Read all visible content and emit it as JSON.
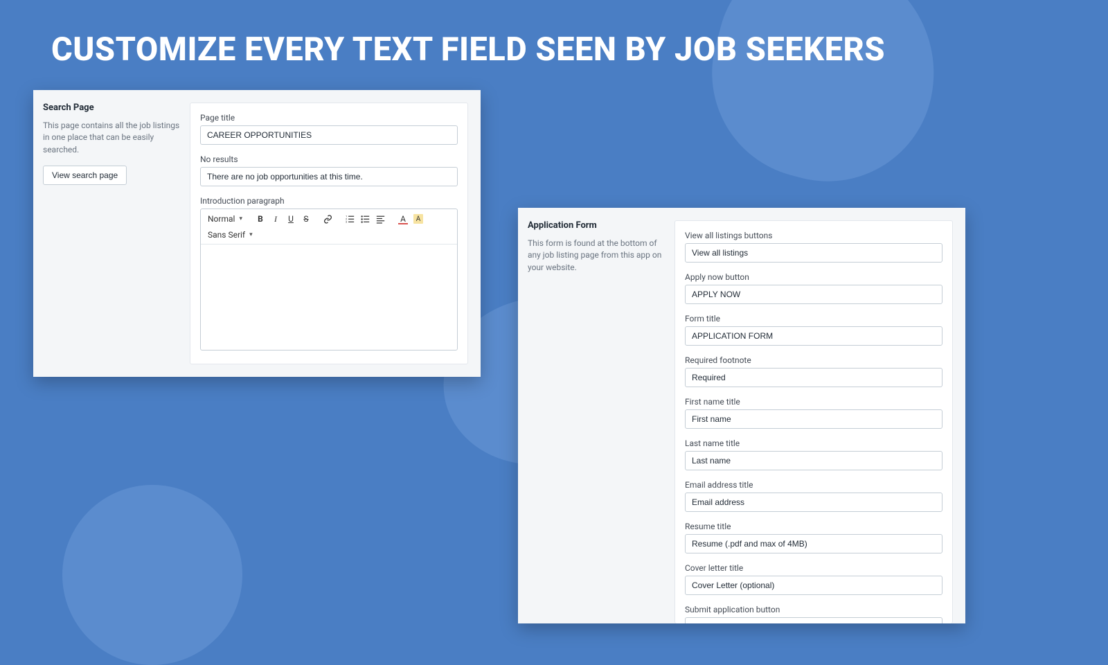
{
  "headline": "CUSTOMIZE EVERY TEXT FIELD SEEN BY JOB SEEKERS",
  "panel1": {
    "side_title": "Search Page",
    "side_desc": "This page contains all the job listings in one place that can be easily searched.",
    "side_button": "View search page",
    "fields": {
      "page_title_label": "Page title",
      "page_title_value": "CAREER OPPORTUNITIES",
      "no_results_label": "No results",
      "no_results_value": "There are no job opportunities at this time.",
      "intro_label": "Introduction paragraph"
    },
    "rte": {
      "format": "Normal",
      "font": "Sans Serif"
    }
  },
  "panel2": {
    "side_title": "Application Form",
    "side_desc": "This form is found at the bottom of any job listing page from this app on your website.",
    "fields": [
      {
        "label": "View all listings buttons",
        "value": "View all listings"
      },
      {
        "label": "Apply now button",
        "value": "APPLY NOW"
      },
      {
        "label": "Form title",
        "value": "APPLICATION FORM"
      },
      {
        "label": "Required footnote",
        "value": "Required"
      },
      {
        "label": "First name title",
        "value": "First name"
      },
      {
        "label": "Last name title",
        "value": "Last name"
      },
      {
        "label": "Email address title",
        "value": "Email address"
      },
      {
        "label": "Resume title",
        "value": "Resume (.pdf and max of 4MB)"
      },
      {
        "label": "Cover letter title",
        "value": "Cover Letter (optional)"
      },
      {
        "label": "Submit application button",
        "value": ""
      }
    ]
  }
}
